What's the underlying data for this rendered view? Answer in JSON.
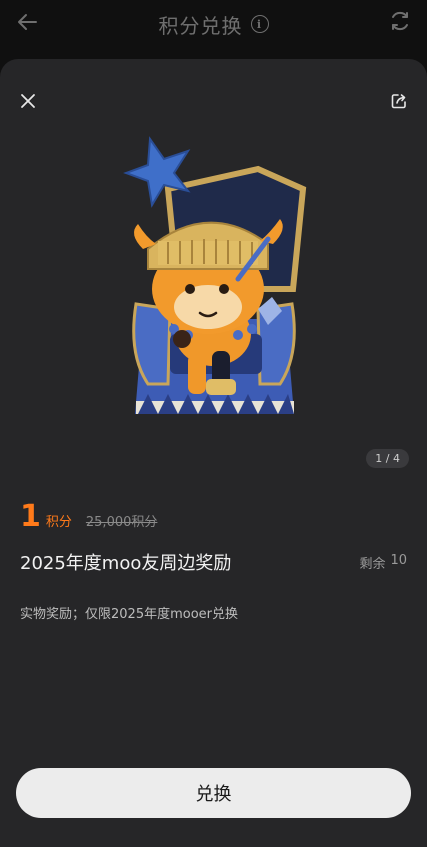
{
  "header": {
    "title": "积分兑换",
    "info_icon": "i"
  },
  "product": {
    "pager": "1 / 4",
    "price": "1",
    "price_unit": "积分",
    "original_price": "25,000积分",
    "title": "2025年度moo友周边奖励",
    "stock_label": "剩余",
    "stock_value": "10",
    "description": "实物奖励；仅限2025年度mooer兑换"
  },
  "actions": {
    "redeem_label": "兑换"
  },
  "colors": {
    "accent": "#ff7a1a",
    "sheet_bg": "#262628",
    "button_bg": "#ececec"
  }
}
